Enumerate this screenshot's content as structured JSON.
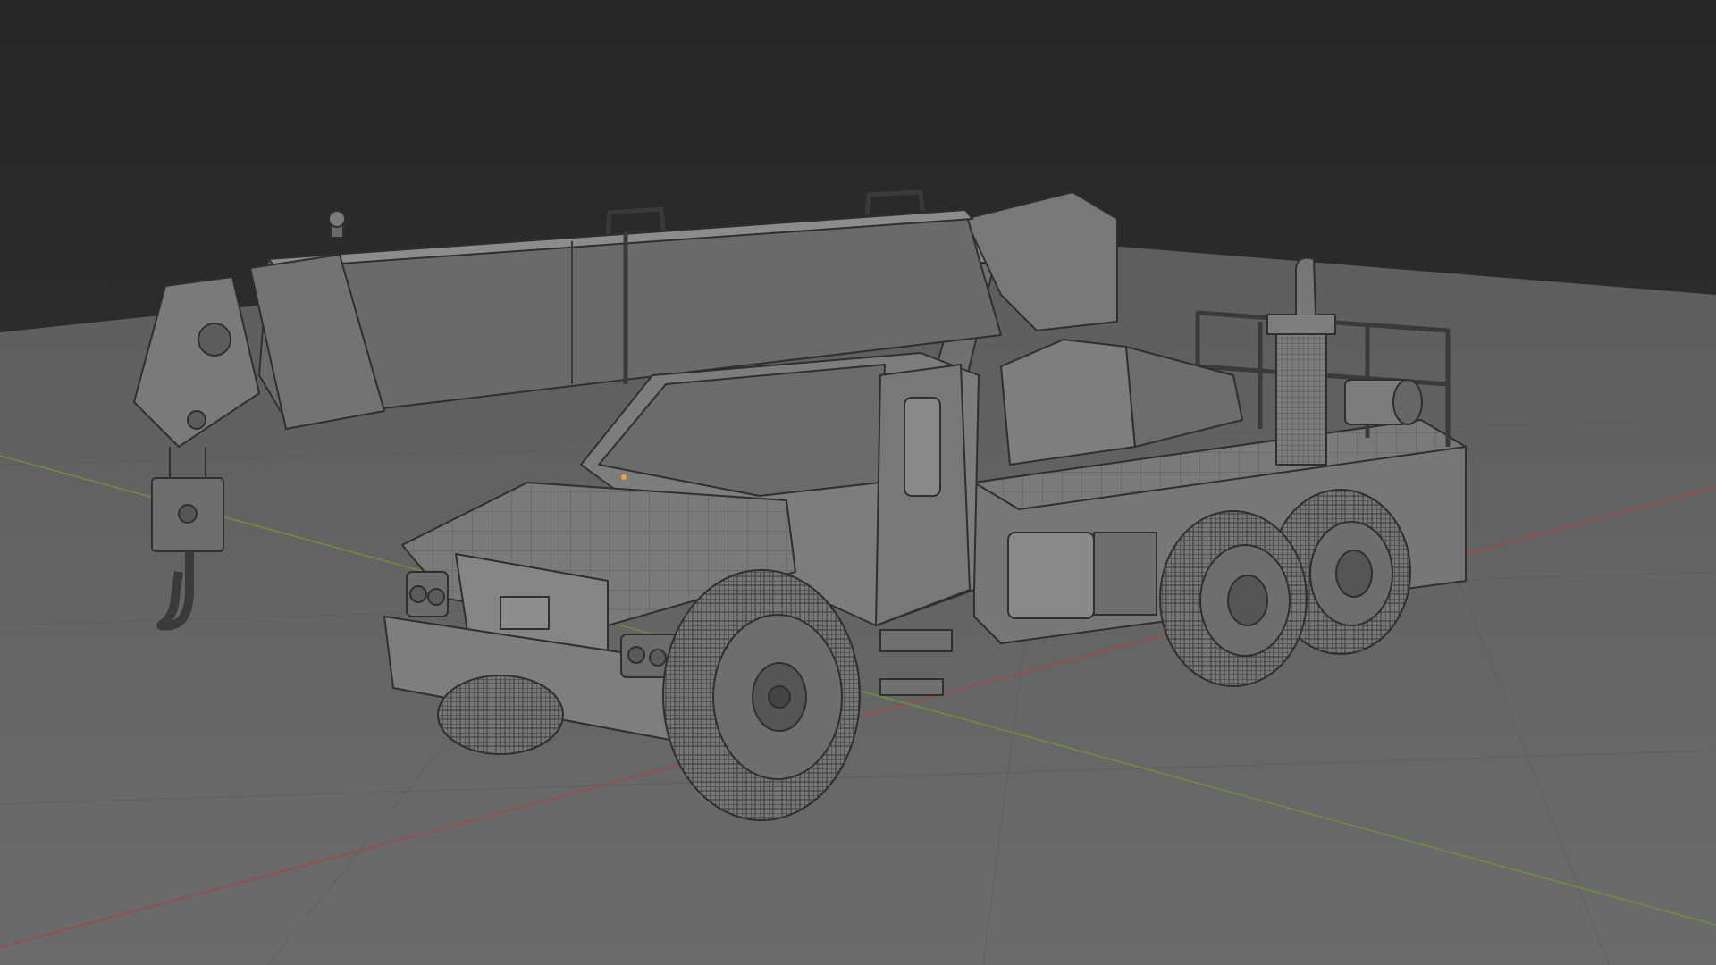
{
  "viewport": {
    "mode": "solid-wireframe",
    "colors": {
      "world_top": "#262626",
      "world_horizon": "#333333",
      "ground": "#666666",
      "ground_far": "#5d5d5d",
      "grid_line": "#5a5a5a",
      "axis_x": "#a04848",
      "axis_y": "#6f8f3c",
      "mesh_fill": "#7a7a7a",
      "mesh_dark": "#565656",
      "mesh_light": "#8e8e8e",
      "wire": "#2f2f2f",
      "origin_dot": "#f0a030"
    },
    "object_icon": "crane-truck-mesh"
  }
}
